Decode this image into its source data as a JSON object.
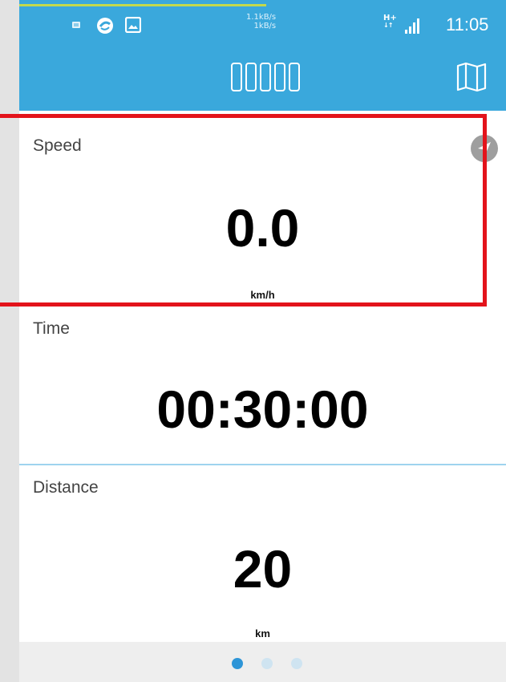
{
  "statusbar": {
    "net_up": "1.1kB/s",
    "net_down": "1kB/s",
    "network_type": "H+",
    "time": "11:05"
  },
  "appbar": {
    "title_icon": "placeholder-boxes",
    "map_icon": "map-icon"
  },
  "speed": {
    "label": "Speed",
    "value": "0.0",
    "unit": "km/h",
    "icon": "navigation-arrow-icon"
  },
  "time": {
    "label": "Time",
    "value": "00:30:00"
  },
  "distance": {
    "label": "Distance",
    "value": "20",
    "unit": "km"
  },
  "pager": {
    "pages": 3,
    "current": 1
  },
  "colors": {
    "appbar": "#3aa8dc",
    "highlight": "#e3131b",
    "active_dot": "#2d95d7",
    "inactive_dot": "#cfe4f1"
  }
}
